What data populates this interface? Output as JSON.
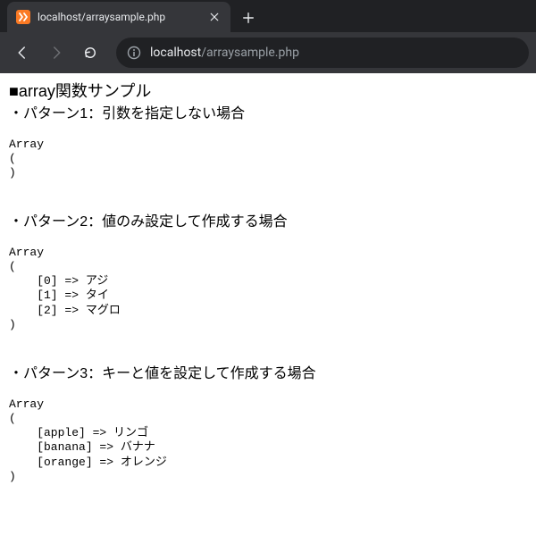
{
  "browser": {
    "tab": {
      "title": "localhost/arraysample.php"
    },
    "url": {
      "host": "localhost",
      "path": "/arraysample.php"
    }
  },
  "page": {
    "heading": "■array関数サンプル",
    "patterns": [
      {
        "label": "・パターン1：引数を指定しない場合",
        "dump": "Array\n(\n)"
      },
      {
        "label": "・パターン2：値のみ設定して作成する場合",
        "dump": "Array\n(\n    [0] => アジ\n    [1] => タイ\n    [2] => マグロ\n)"
      },
      {
        "label": "・パターン3：キーと値を設定して作成する場合",
        "dump": "Array\n(\n    [apple] => リンゴ\n    [banana] => バナナ\n    [orange] => オレンジ\n)"
      }
    ]
  }
}
